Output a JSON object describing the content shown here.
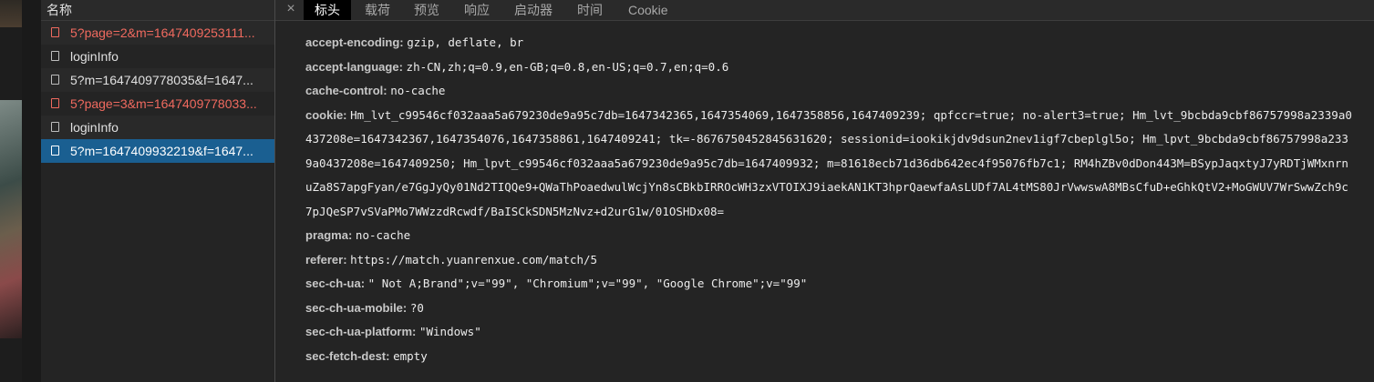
{
  "request_list": {
    "header": "名称",
    "items": [
      {
        "name": "5?page=2&m=1647409253111...",
        "error": true,
        "selected": false
      },
      {
        "name": "loginInfo",
        "error": false,
        "selected": false
      },
      {
        "name": "5?m=1647409778035&f=1647...",
        "error": false,
        "selected": false
      },
      {
        "name": "5?page=3&m=1647409778033...",
        "error": true,
        "selected": false
      },
      {
        "name": "loginInfo",
        "error": false,
        "selected": false
      },
      {
        "name": "5?m=1647409932219&f=1647...",
        "error": false,
        "selected": true
      }
    ]
  },
  "tabs": {
    "close": "×",
    "headers": "标头",
    "payload": "载荷",
    "preview": "预览",
    "response": "响应",
    "initiator": "启动器",
    "timing": "时间",
    "cookie": "Cookie"
  },
  "request_headers": [
    {
      "key": "accept-encoding:",
      "value": "gzip, deflate, br"
    },
    {
      "key": "accept-language:",
      "value": "zh-CN,zh;q=0.9,en-GB;q=0.8,en-US;q=0.7,en;q=0.6"
    },
    {
      "key": "cache-control:",
      "value": "no-cache"
    },
    {
      "key": "cookie:",
      "value": "Hm_lvt_c99546cf032aaa5a679230de9a95c7db=1647342365,1647354069,1647358856,1647409239; qpfccr=true; no-alert3=true; Hm_lvt_9bcbda9cbf86757998a2339a0437208e=1647342367,1647354076,1647358861,1647409241; tk=-8676750452845631620; sessionid=iookikjdv9dsun2nev1igf7cbeplgl5o; Hm_lpvt_9bcbda9cbf86757998a2339a0437208e=1647409250; Hm_lpvt_c99546cf032aaa5a679230de9a95c7db=1647409932; m=81618ecb71d36db642ec4f95076fb7c1; RM4hZBv0dDon443M=BSypJaqxtyJ7yRDTjWMxnrnuZa8S7apgFyan/e7GgJyQy01Nd2TIQQe9+QWaThPoaedwulWcjYn8sCBkbIRROcWH3zxVTOIXJ9iaekAN1KT3hprQaewfaAsLUDf7AL4tMS80JrVwwswA8MBsCfuD+eGhkQtV2+MoGWUV7WrSwwZch9c7pJQeSP7vSVaPMo7WWzzdRcwdf/BaISCkSDN5MzNvz+d2urG1w/01OSHDx08="
    },
    {
      "key": "pragma:",
      "value": "no-cache"
    },
    {
      "key": "referer:",
      "value": "https://match.yuanrenxue.com/match/5"
    },
    {
      "key": "sec-ch-ua:",
      "value": "\" Not A;Brand\";v=\"99\", \"Chromium\";v=\"99\", \"Google Chrome\";v=\"99\""
    },
    {
      "key": "sec-ch-ua-mobile:",
      "value": "?0"
    },
    {
      "key": "sec-ch-ua-platform:",
      "value": "\"Windows\""
    },
    {
      "key": "sec-fetch-dest:",
      "value": "empty"
    }
  ],
  "colors": {
    "error_text": "#f06a5f",
    "selected_bg": "#1a5f91",
    "panel_bg": "#242424"
  }
}
